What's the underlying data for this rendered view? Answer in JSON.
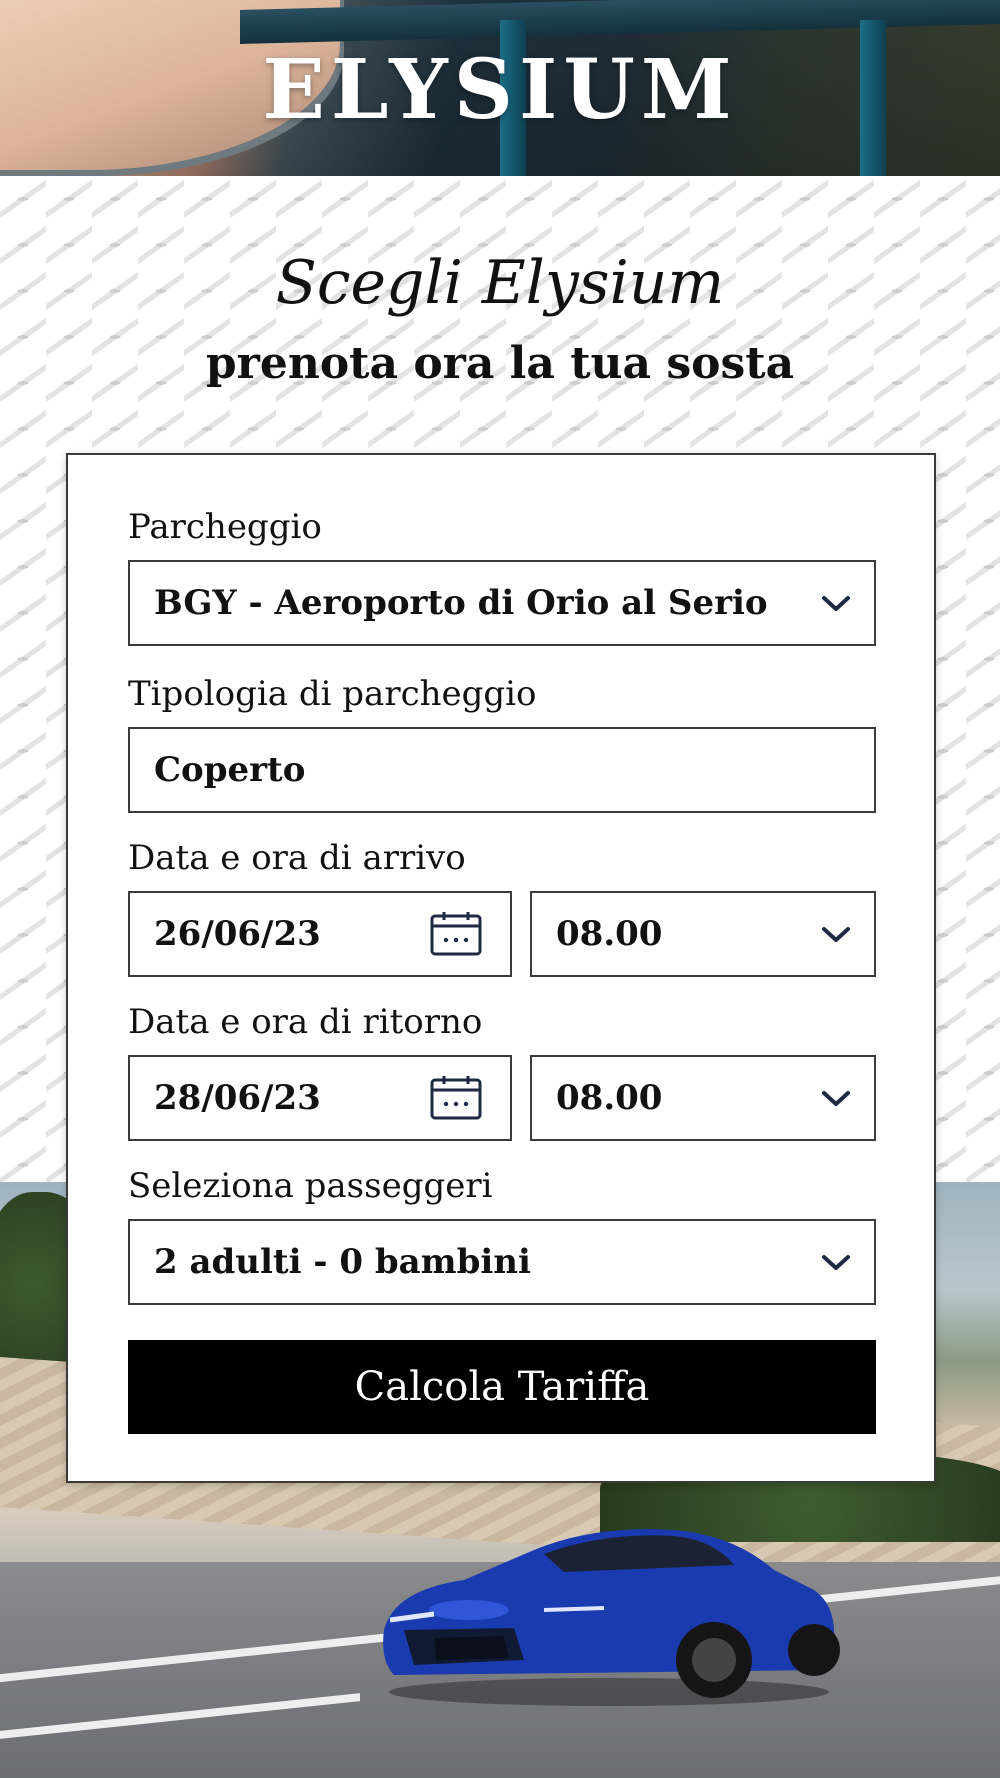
{
  "brand": {
    "logo_text": "ELYSIUM"
  },
  "hero": {
    "script_title": "Scegli Elysium",
    "subtitle": "prenota ora la tua sosta"
  },
  "form": {
    "parking": {
      "label": "Parcheggio",
      "value": "BGY - Aeroporto di Orio al Serio",
      "icon": "chevron-down-icon"
    },
    "parking_type": {
      "label": "Tipologia di parcheggio",
      "value": "Coperto"
    },
    "arrival": {
      "label": "Data e ora di arrivo",
      "date": "26/06/23",
      "time": "08.00",
      "date_icon": "calendar-icon",
      "time_icon": "chevron-down-icon"
    },
    "return": {
      "label": "Data e ora di ritorno",
      "date": "28/06/23",
      "time": "08.00",
      "date_icon": "calendar-icon",
      "time_icon": "chevron-down-icon"
    },
    "passengers": {
      "label": "Seleziona passeggeri",
      "value": "2 adulti - 0 bambini",
      "icon": "chevron-down-icon"
    },
    "submit_label": "Calcola Tariffa"
  },
  "colors": {
    "cta_background": "#000000",
    "cta_text": "#ffffff",
    "field_border": "#3c3c3c",
    "icon_color": "#1e2a44"
  }
}
